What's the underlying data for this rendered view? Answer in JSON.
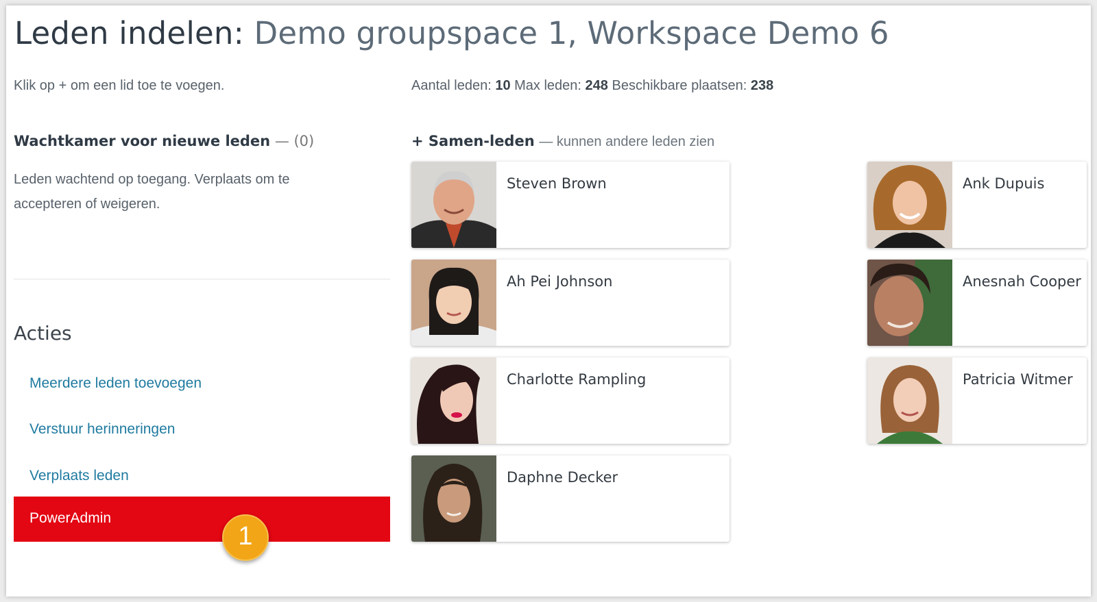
{
  "header": {
    "title_prefix": "Leden indelen:",
    "title_group": "Demo groupspace 1, Workspace Demo 6"
  },
  "hint": "Klik op + om een lid toe te voegen.",
  "stats": {
    "members_label": "Aantal leden:",
    "members_value": "10",
    "max_label": "Max leden:",
    "max_value": "248",
    "available_label": "Beschikbare plaatsen:",
    "available_value": "238"
  },
  "waiting_room": {
    "title": "Wachtkamer voor nieuwe leden",
    "count": "— (0)",
    "description": "Leden wachtend op toegang. Verplaats om te accepteren of weigeren."
  },
  "actions": {
    "title": "Acties",
    "items": [
      "Meerdere leden toevoegen",
      "Verstuur herinneringen",
      "Verplaats leden"
    ],
    "power_admin": "PowerAdmin"
  },
  "badge": "1",
  "group": {
    "title": "+ Samen-leden",
    "note": "— kunnen andere leden zien"
  },
  "members": [
    "Steven Brown",
    "Ah Pei Johnson",
    "Charlotte Rampling",
    "Daphne Decker",
    "Ank Dupuis",
    "Anesnah Cooper",
    "Patricia Witmer"
  ],
  "colors": {
    "accent_red": "#e30613",
    "link_blue": "#1f7aa0",
    "badge_orange": "#f2a516"
  }
}
